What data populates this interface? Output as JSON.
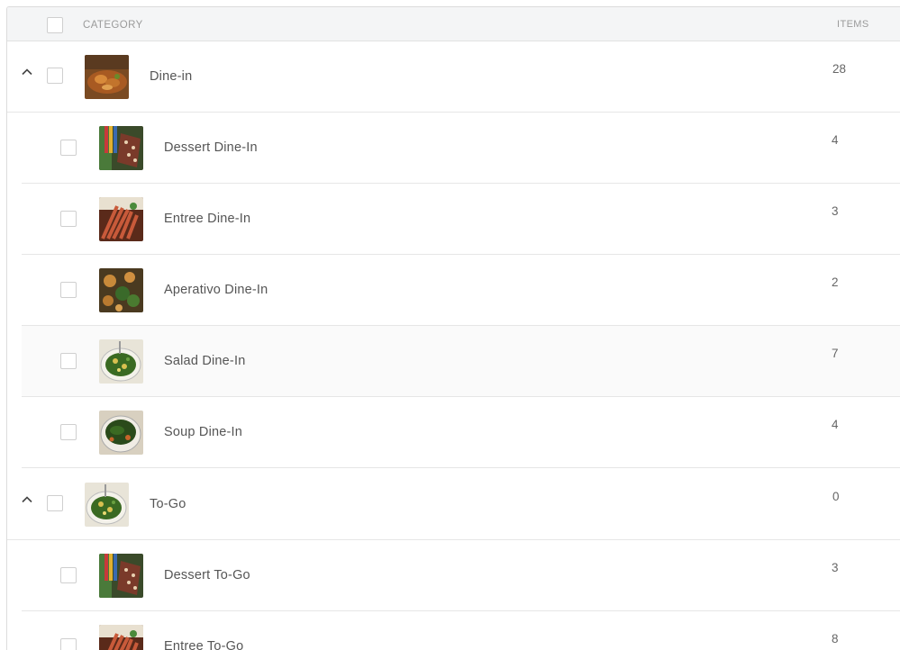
{
  "header": {
    "category_label": "CATEGORY",
    "items_label": "ITEMS"
  },
  "colors": {
    "header_bg": "#f4f5f6",
    "border": "#e6e6e6",
    "text": "#555555",
    "muted": "#9a9a9a"
  },
  "rows": [
    {
      "name": "Dine-in",
      "count": "28",
      "level": "parent",
      "expanded": true,
      "thumb": "fried-dish"
    },
    {
      "name": "Dessert Dine-In",
      "count": "4",
      "level": "child",
      "thumb": "dessert"
    },
    {
      "name": "Entree Dine-In",
      "count": "3",
      "level": "child",
      "thumb": "entree"
    },
    {
      "name": "Aperativo Dine-In",
      "count": "2",
      "level": "child",
      "thumb": "aperativo"
    },
    {
      "name": "Salad Dine-In",
      "count": "7",
      "level": "child",
      "thumb": "salad"
    },
    {
      "name": "Soup Dine-In",
      "count": "4",
      "level": "child",
      "thumb": "soup"
    },
    {
      "name": "To-Go",
      "count": "0",
      "level": "parent",
      "expanded": true,
      "thumb": "salad"
    },
    {
      "name": "Dessert To-Go",
      "count": "3",
      "level": "child",
      "thumb": "dessert"
    },
    {
      "name": "Entree To-Go",
      "count": "8",
      "level": "child",
      "thumb": "entree"
    }
  ]
}
